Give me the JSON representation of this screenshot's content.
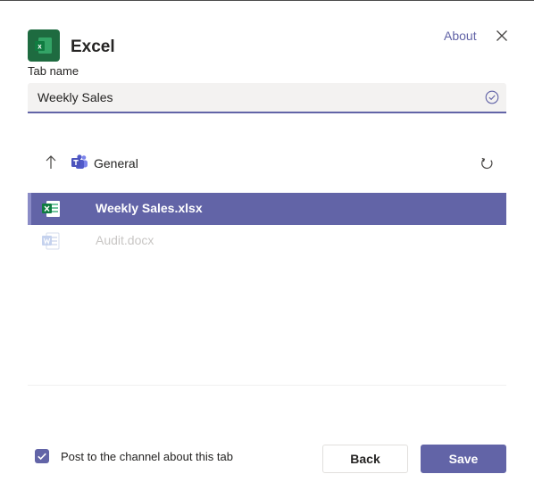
{
  "header": {
    "app_name": "Excel",
    "about_label": "About",
    "app_icon": "excel-icon",
    "close_icon": "close-icon"
  },
  "tab_name": {
    "label": "Tab name",
    "value": "Weekly Sales",
    "valid_icon": "check-circle-icon"
  },
  "breadcrumb": {
    "up_icon": "arrow-up-icon",
    "channel_icon": "teams-icon",
    "folder": "General",
    "refresh_icon": "refresh-icon"
  },
  "files": [
    {
      "name": "Weekly Sales.xlsx",
      "type": "xlsx",
      "icon": "excel-file-icon",
      "selected": true,
      "enabled": true
    },
    {
      "name": "Audit.docx",
      "type": "docx",
      "icon": "word-file-icon",
      "selected": false,
      "enabled": false
    }
  ],
  "footer": {
    "post_label": "Post to the channel about this tab",
    "post_checked": true,
    "back_label": "Back",
    "save_label": "Save"
  },
  "colors": {
    "accent": "#6264a7",
    "excel_green": "#1e6b40",
    "disabled_text": "#c8c6c4"
  }
}
